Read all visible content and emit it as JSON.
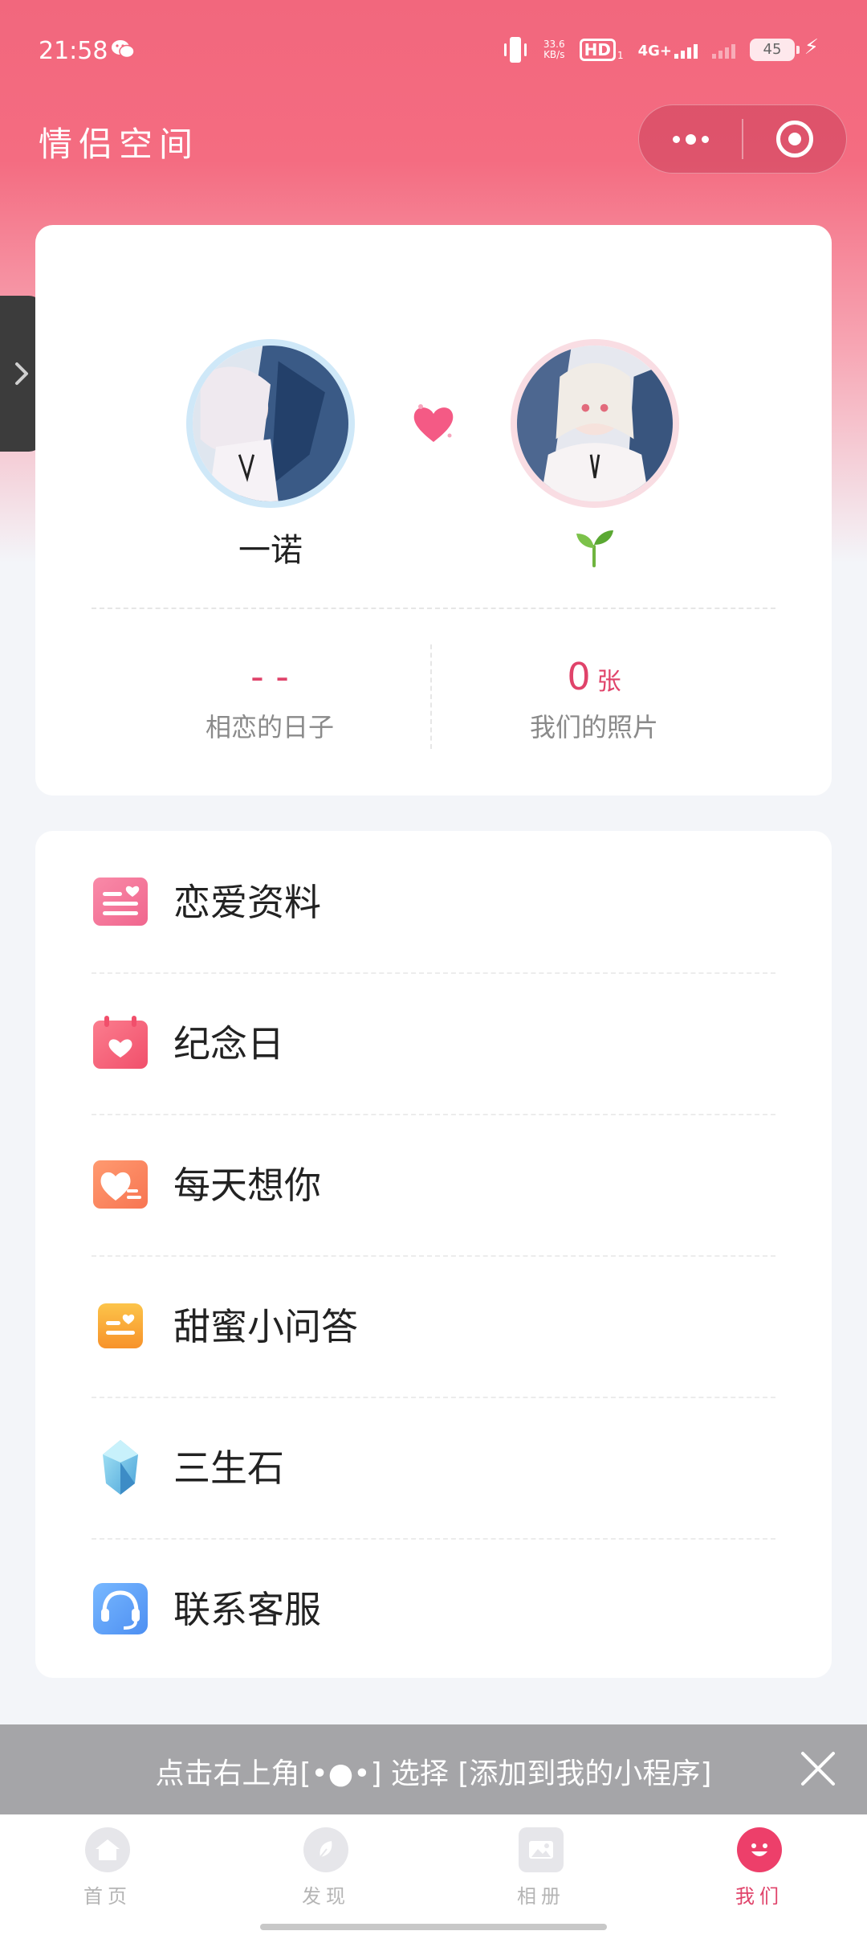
{
  "status_bar": {
    "time": "21:58",
    "speed_value": "33.6",
    "speed_unit": "KB/s",
    "hd": "HD",
    "hd_sub": "1",
    "network": "4G+",
    "battery": "45"
  },
  "header": {
    "title": "情侣空间"
  },
  "profile": {
    "left_name": "一诺",
    "stats": [
      {
        "value": "- -",
        "unit": "",
        "label": "相恋的日子"
      },
      {
        "value": "0",
        "unit": "张",
        "label": "我们的照片"
      }
    ]
  },
  "menu": {
    "items": [
      {
        "label": "恋爱资料",
        "icon": "love-profile-icon"
      },
      {
        "label": "纪念日",
        "icon": "calendar-heart-icon"
      },
      {
        "label": "每天想你",
        "icon": "heart-message-icon"
      },
      {
        "label": "甜蜜小问答",
        "icon": "quiz-card-icon"
      },
      {
        "label": "三生石",
        "icon": "crystal-icon"
      },
      {
        "label": "联系客服",
        "icon": "headset-icon"
      }
    ]
  },
  "tip_bar": {
    "text": "点击右上角[•●•] 选择 [添加到我的小程序]"
  },
  "tab_bar": {
    "tabs": [
      {
        "label": "首页",
        "icon": "home-icon",
        "active": false
      },
      {
        "label": "发现",
        "icon": "discover-icon",
        "active": false
      },
      {
        "label": "相册",
        "icon": "album-icon",
        "active": false
      },
      {
        "label": "我们",
        "icon": "smile-icon",
        "active": true
      }
    ]
  },
  "colors": {
    "brand": "#f2677d",
    "accent": "#e0436a"
  }
}
